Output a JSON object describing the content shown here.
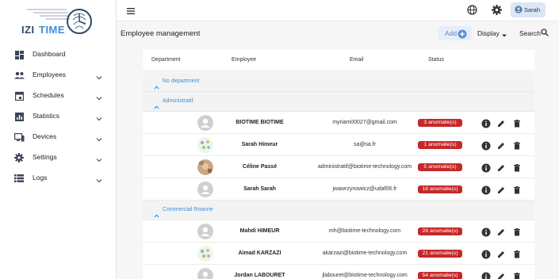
{
  "app": {
    "logo_text_izi": "IZI",
    "logo_text_time": "TIME"
  },
  "sidebar": {
    "items": [
      {
        "label": "Dashboard",
        "icon": "dashboard-icon",
        "expandable": false
      },
      {
        "label": "Employees",
        "icon": "people-icon",
        "expandable": true
      },
      {
        "label": "Schedules",
        "icon": "calendar-icon",
        "expandable": true
      },
      {
        "label": "Statistics",
        "icon": "bar-chart-icon",
        "expandable": true
      },
      {
        "label": "Devices",
        "icon": "devices-icon",
        "expandable": true
      },
      {
        "label": "Settings",
        "icon": "gear-icon",
        "expandable": true
      },
      {
        "label": "Logs",
        "icon": "list-icon",
        "expandable": true
      }
    ]
  },
  "topbar": {
    "user_name": "Sarah"
  },
  "header": {
    "title": "Employee management",
    "add_label": "Add",
    "display_label": "Display",
    "search_label": "Search"
  },
  "table": {
    "columns": {
      "department": "Department",
      "employee": "Employee",
      "email": "Email",
      "status": "Status"
    },
    "groups": [
      {
        "label": "No department",
        "rows": []
      },
      {
        "label": "Administratif",
        "rows": [
          {
            "name": "BIOTIME BIOTIME",
            "email": "myriam00027@gmail.com",
            "status": "3 anomalie(s)",
            "avatar": "default"
          },
          {
            "name": "Sarah Himeur",
            "email": "sa@sa.fr",
            "status": "1 anomalie(s)",
            "avatar": "pattern"
          },
          {
            "name": "Céline Passé",
            "email": "administratif@biotime-technology.com",
            "status": "5 anomalie(s)",
            "avatar": "photo"
          },
          {
            "name": "Sarah Sarah",
            "email": "jwawrzynowicz@udaf06.fr",
            "status": "18 anomalie(s)",
            "avatar": "default"
          }
        ]
      },
      {
        "label": "Commercial Roanne",
        "rows": [
          {
            "name": "Mahdi HIMEUR",
            "email": "mh@biotime-technology.com",
            "status": "28 anomalie(s)",
            "avatar": "default"
          },
          {
            "name": "Aimad KARZAZI",
            "email": "akarzazi@biotime-technology.com",
            "status": "21 anomalie(s)",
            "avatar": "pattern"
          },
          {
            "name": "Jordan LABOURET",
            "email": "jlabouret@biotime-technology.com",
            "status": "54 anomalie(s)",
            "avatar": "default"
          }
        ]
      }
    ]
  },
  "colors": {
    "accent": "#3f8fd2",
    "badge": "#c62828",
    "chip_bg": "#dbe6f6"
  }
}
